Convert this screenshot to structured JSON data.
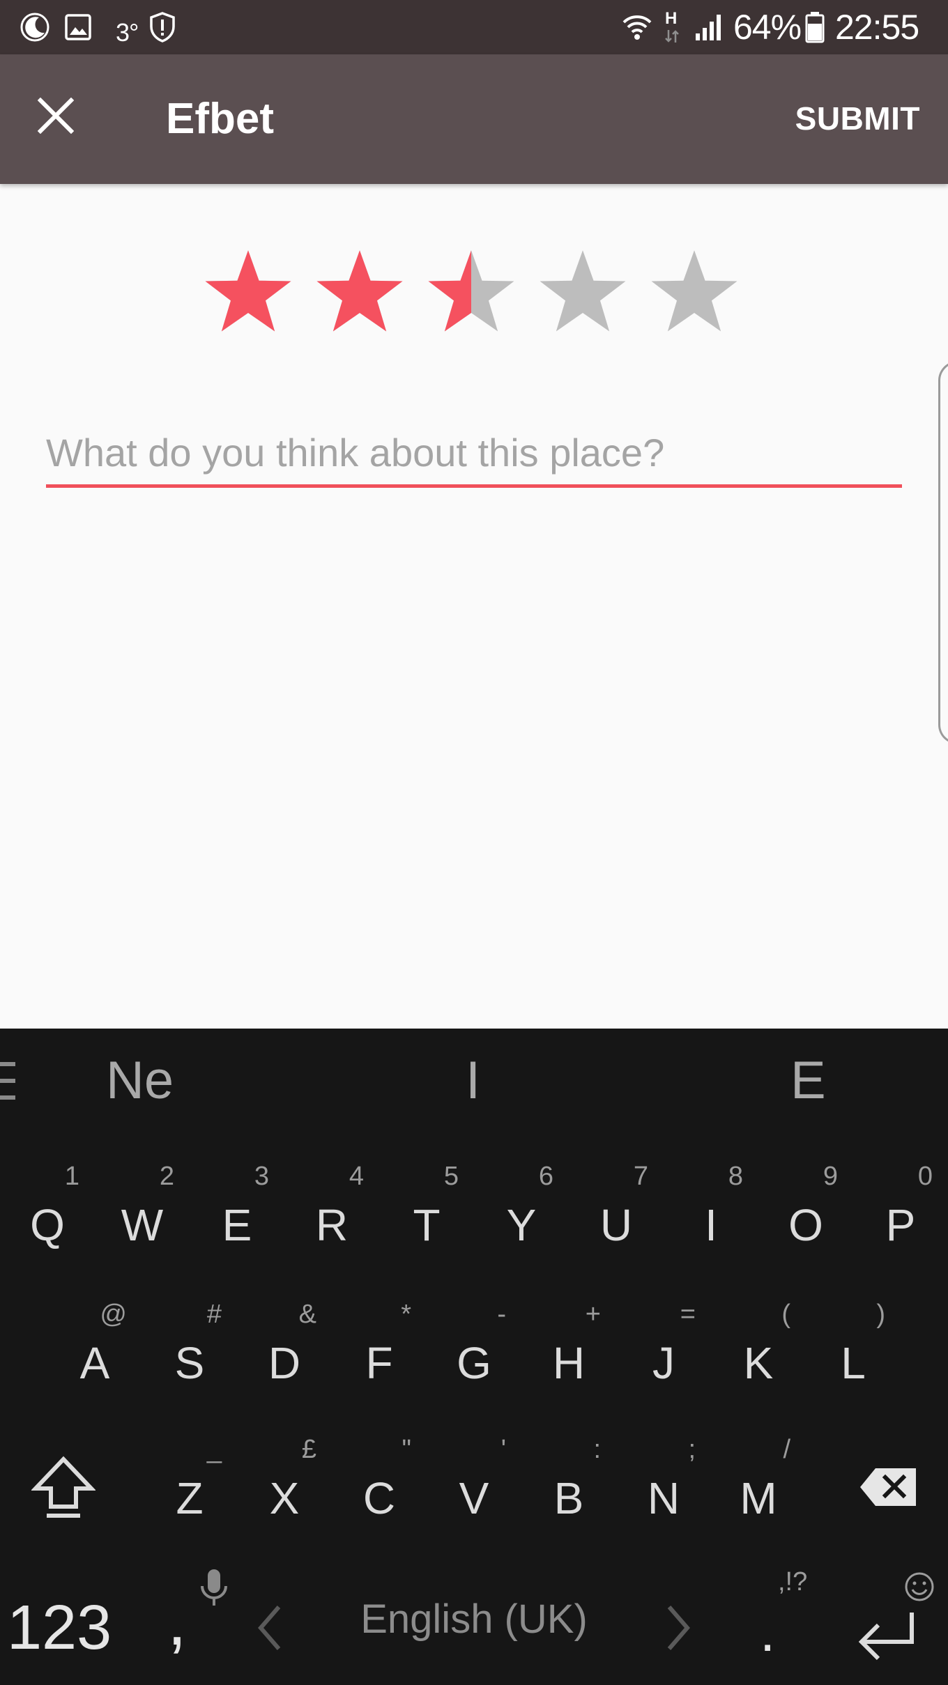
{
  "status_bar": {
    "temperature": "3°",
    "network_type": "H",
    "battery": "64%",
    "time": "22:55",
    "icons": [
      "moon-icon",
      "gallery-icon",
      "shield-alert-icon",
      "wifi-icon",
      "mobile-data-icon",
      "signal-icon",
      "battery-icon"
    ]
  },
  "app_bar": {
    "title": "Efbet",
    "submit_label": "SUBMIT",
    "close_icon": "close-icon"
  },
  "rating": {
    "value": 2.5,
    "max": 5,
    "filled_color": "#f5515f",
    "empty_color": "#bdbdbd"
  },
  "review": {
    "placeholder": "What do you think about this place?",
    "value": "",
    "accent_color": "#f0505a"
  },
  "keyboard": {
    "suggestions": [
      "Ne",
      "I",
      "E"
    ],
    "rows": [
      [
        {
          "label": "Q",
          "hint": "1"
        },
        {
          "label": "W",
          "hint": "2"
        },
        {
          "label": "E",
          "hint": "3"
        },
        {
          "label": "R",
          "hint": "4"
        },
        {
          "label": "T",
          "hint": "5"
        },
        {
          "label": "Y",
          "hint": "6"
        },
        {
          "label": "U",
          "hint": "7"
        },
        {
          "label": "I",
          "hint": "8"
        },
        {
          "label": "O",
          "hint": "9"
        },
        {
          "label": "P",
          "hint": "0"
        }
      ],
      [
        {
          "label": "A",
          "hint": "@"
        },
        {
          "label": "S",
          "hint": "#"
        },
        {
          "label": "D",
          "hint": "&"
        },
        {
          "label": "F",
          "hint": "*"
        },
        {
          "label": "G",
          "hint": "-"
        },
        {
          "label": "H",
          "hint": "+"
        },
        {
          "label": "J",
          "hint": "="
        },
        {
          "label": "K",
          "hint": "("
        },
        {
          "label": "L",
          "hint": ")"
        }
      ],
      [
        {
          "label": "Z",
          "hint": "_"
        },
        {
          "label": "X",
          "hint": "£"
        },
        {
          "label": "C",
          "hint": "\""
        },
        {
          "label": "V",
          "hint": "'"
        },
        {
          "label": "B",
          "hint": ":"
        },
        {
          "label": "N",
          "hint": ";"
        },
        {
          "label": "M",
          "hint": "/"
        }
      ]
    ],
    "numbers_key": "123",
    "comma_key": ",",
    "space_label": "English (UK)",
    "period_key": ".",
    "punct_hint": ",!?",
    "icons": [
      "menu-icon",
      "shift-icon",
      "backspace-icon",
      "mic-icon",
      "chevron-left-icon",
      "chevron-right-icon",
      "smiley-icon",
      "enter-icon"
    ]
  }
}
